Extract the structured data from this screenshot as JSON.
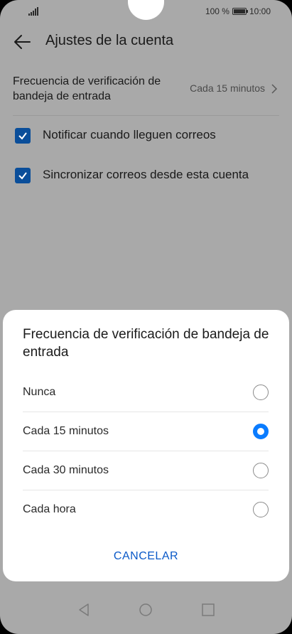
{
  "status": {
    "battery_percent": "100 %",
    "time": "10:00"
  },
  "header": {
    "title": "Ajustes de la cuenta",
    "back_icon": "arrow-left-icon"
  },
  "settings": {
    "frequency_label": "Frecuencia de verificación de bandeja de entrada",
    "frequency_value": "Cada 15 minutos",
    "checkboxes": [
      {
        "label": "Notificar cuando lleguen correos",
        "checked": true
      },
      {
        "label": "Sincronizar correos desde esta cuenta",
        "checked": true
      }
    ]
  },
  "dialog": {
    "title": "Frecuencia de verificación de bandeja de entrada",
    "options": [
      {
        "label": "Nunca",
        "selected": false
      },
      {
        "label": "Cada 15 minutos",
        "selected": true
      },
      {
        "label": "Cada 30 minutos",
        "selected": false
      },
      {
        "label": "Cada hora",
        "selected": false
      }
    ],
    "cancel_label": "CANCELAR"
  },
  "colors": {
    "accent": "#0a7cff",
    "checkbox": "#0a4e9a",
    "cancel_text": "#0a59c8",
    "overlay": "#a9a9a9"
  }
}
